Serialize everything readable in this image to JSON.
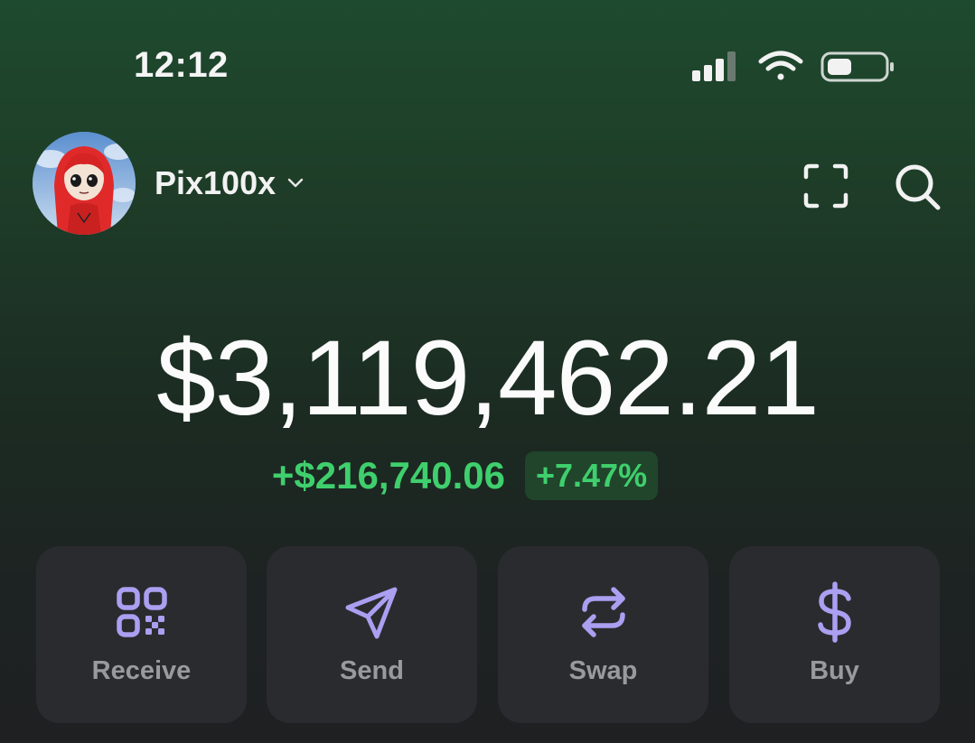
{
  "status_bar": {
    "time": "12:12",
    "icons": [
      "cellular-signal-icon",
      "wifi-icon",
      "battery-icon"
    ]
  },
  "header": {
    "account_name": "Pix100x",
    "icons": [
      "avatar",
      "chevron-down-icon",
      "scan-icon",
      "search-icon"
    ]
  },
  "portfolio": {
    "balance": "$3,119,462.21",
    "change_amount": "+$216,740.06",
    "change_percent": "+7.47%"
  },
  "actions": [
    {
      "label": "Receive",
      "icon": "qr-code-icon"
    },
    {
      "label": "Send",
      "icon": "send-icon"
    },
    {
      "label": "Swap",
      "icon": "swap-icon"
    },
    {
      "label": "Buy",
      "icon": "dollar-icon"
    }
  ],
  "colors": {
    "background_top": "#1e4a2f",
    "background_bottom": "#1e2022",
    "positive": "#3fcf6d",
    "positive_badge_bg": "#20452b",
    "action_icon": "#ab9ff2",
    "action_card": "#2a2b2e",
    "action_label": "#9a9a9e"
  }
}
